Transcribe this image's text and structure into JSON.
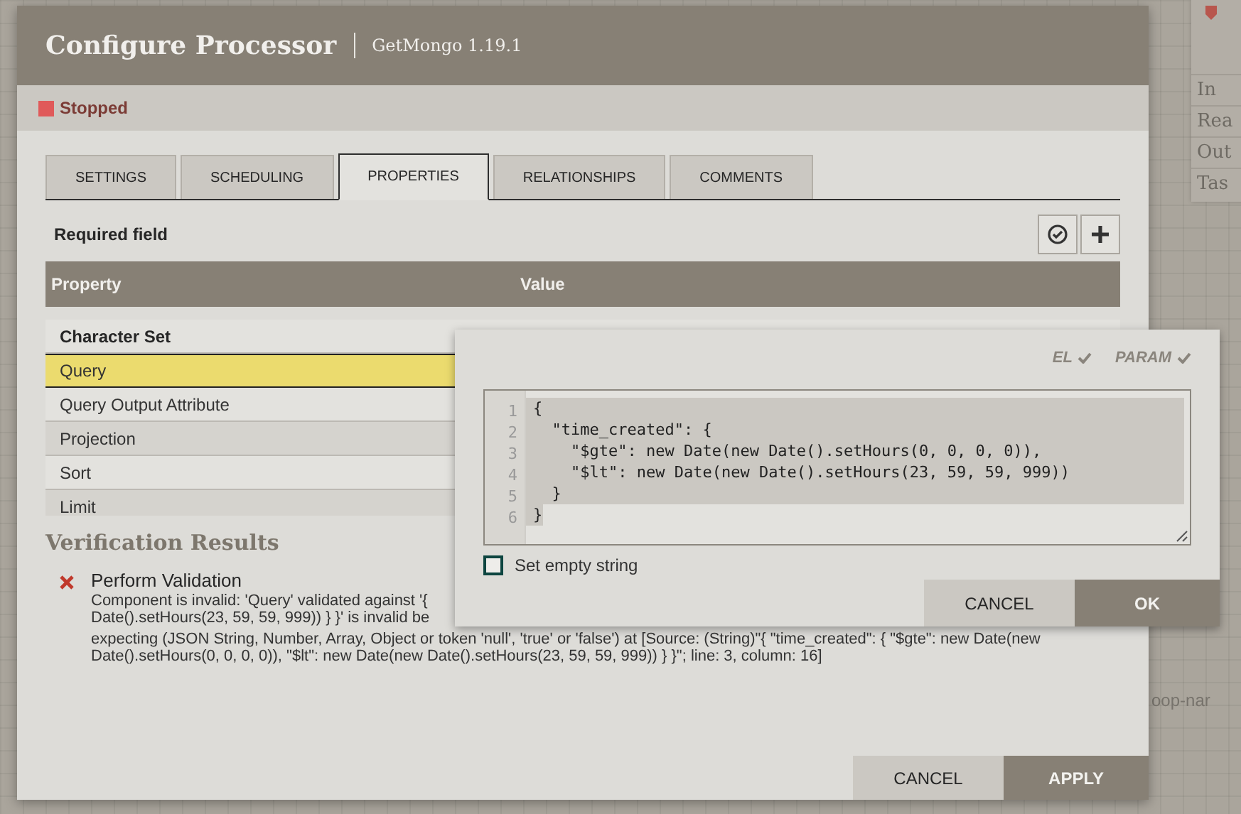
{
  "canvas": {
    "panel_rows": [
      "In",
      "Rea",
      "Out",
      "Tas"
    ],
    "label": "oop-nar"
  },
  "dialog": {
    "title": "Configure Processor",
    "subtitle": "GetMongo 1.19.1",
    "status": {
      "label": "Stopped"
    },
    "tabs": [
      {
        "label": "SETTINGS",
        "selected": false
      },
      {
        "label": "SCHEDULING",
        "selected": false
      },
      {
        "label": "PROPERTIES",
        "selected": true
      },
      {
        "label": "RELATIONSHIPS",
        "selected": false
      },
      {
        "label": "COMMENTS",
        "selected": false
      }
    ],
    "required_label": "Required field",
    "table": {
      "columns": [
        "Property",
        "Value"
      ],
      "rows": [
        {
          "name": "Character Set",
          "required": true,
          "selected": false
        },
        {
          "name": "Query",
          "required": false,
          "selected": true
        },
        {
          "name": "Query Output Attribute",
          "required": false,
          "selected": false
        },
        {
          "name": "Projection",
          "required": false,
          "selected": false
        },
        {
          "name": "Sort",
          "required": false,
          "selected": false
        },
        {
          "name": "Limit",
          "required": false,
          "selected": false
        }
      ]
    },
    "verification": {
      "title": "Verification Results",
      "items": [
        {
          "title": "Perform Validation",
          "message_lines": [
            "Component is invalid: 'Query' validated against '{",
            "Date().setHours(23, 59, 59, 999)) } }' is invalid be",
            "expecting (JSON String, Number, Array, Object or token 'null', 'true' or 'false') at [Source: (String)\"{ \"time_created\": { \"$gte\": new Date(new",
            "Date().setHours(0, 0, 0, 0)), \"$lt\": new Date(new Date().setHours(23, 59, 59, 999)) } }\"; line: 3, column: 16]"
          ]
        }
      ]
    },
    "buttons": [
      {
        "label": "CANCEL",
        "kind": "secondary"
      },
      {
        "label": "APPLY",
        "kind": "primary"
      }
    ]
  },
  "editor_popup": {
    "flags": [
      {
        "label": "EL",
        "supported": true
      },
      {
        "label": "PARAM",
        "supported": true
      }
    ],
    "code_lines": [
      {
        "number": "1",
        "text": "{"
      },
      {
        "number": "2",
        "text": "  \"time_created\": {"
      },
      {
        "number": "3",
        "text": "    \"$gte\": new Date(new Date().setHours(0, 0, 0, 0)),"
      },
      {
        "number": "4",
        "text": "    \"$lt\": new Date(new Date().setHours(23, 59, 59, 999))"
      },
      {
        "number": "5",
        "text": "  }"
      },
      {
        "number": "6",
        "text": "}"
      }
    ],
    "set_empty_string": {
      "label": "Set empty string",
      "checked": false
    },
    "buttons": [
      {
        "label": "CANCEL",
        "kind": "secondary"
      },
      {
        "label": "OK",
        "kind": "primary"
      }
    ]
  }
}
